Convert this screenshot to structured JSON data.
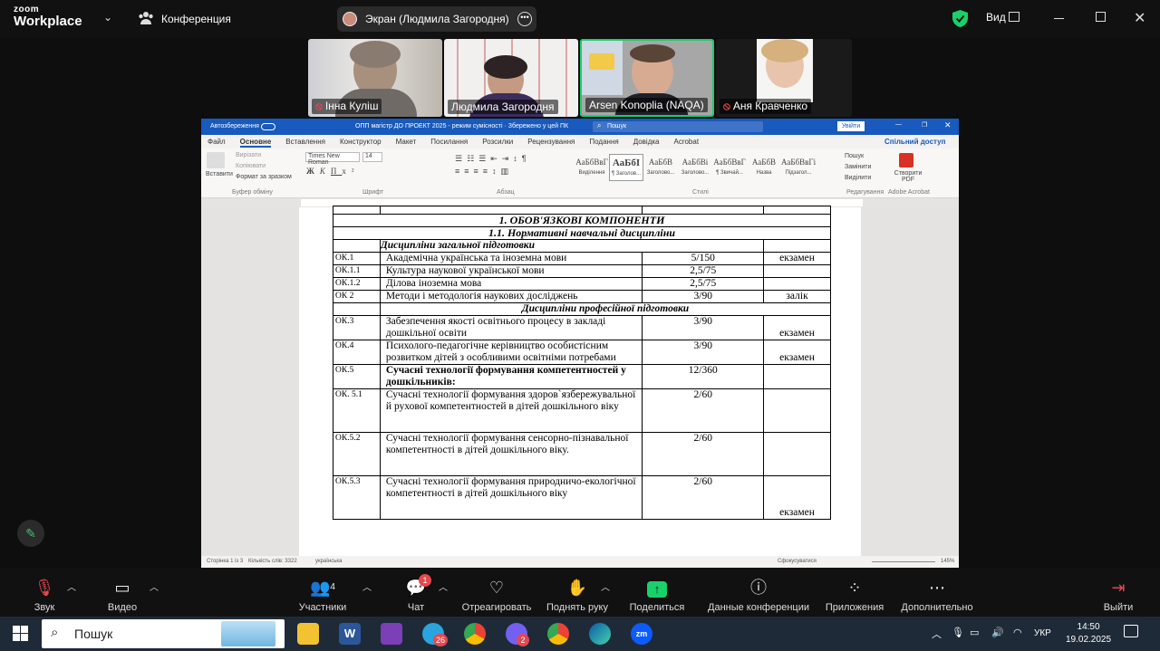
{
  "zoom": {
    "logo_top": "zoom",
    "logo_bottom": "Workplace",
    "conference_label": "Конференция",
    "share_label": "Экран (Людмила Загородня)",
    "view_label": "Вид"
  },
  "participants": [
    {
      "name": "Інна Куліш",
      "muted": true
    },
    {
      "name": "Людмила Загородня",
      "muted": false
    },
    {
      "name": "Arsen Konoplia (NAQA)",
      "muted": false,
      "active": true
    },
    {
      "name": "Аня Кравченко",
      "muted": true
    }
  ],
  "word": {
    "autosave": "Автозбереження",
    "doc_title": "ОПП магістр ДО ПРОЕКТ 2025 - режим сумісності · Збережено у цей ПК",
    "search_placeholder": "Пошук",
    "signin": "Увійти",
    "tabs": [
      "Файл",
      "Основне",
      "Вставлення",
      "Конструктор",
      "Макет",
      "Посилання",
      "Розсилки",
      "Рецензування",
      "Подання",
      "Довідка",
      "Acrobat"
    ],
    "share": "Спільний доступ",
    "ribbon": {
      "paste": "Вставити",
      "cut": "Вирізати",
      "copy": "Копіювати",
      "format_painter": "Формат за зразком",
      "clipboard": "Буфер обміну",
      "font_name": "Times New Roman",
      "font_size": "14",
      "font_group": "Шрифт",
      "paragraph_group": "Абзац",
      "styles": [
        {
          "preview": "АаБбВвГ",
          "label": "Виділення"
        },
        {
          "preview": "АаБбІ",
          "label": "¶ Заголов..."
        },
        {
          "preview": "АаБбВ",
          "label": "Заголово..."
        },
        {
          "preview": "АаБбВі",
          "label": "Заголово..."
        },
        {
          "preview": "АаБбВвГ",
          "label": "¶ Звичай..."
        },
        {
          "preview": "АаБбВ",
          "label": "Назва"
        },
        {
          "preview": "АаБбВвГі",
          "label": "Підзагол..."
        }
      ],
      "styles_group": "Стилі",
      "find": "Пошук",
      "replace": "Замінити",
      "select": "Виділити",
      "editing_group": "Редагування",
      "create_pdf": "Створити PDF",
      "acrobat_group": "Adobe Acrobat"
    },
    "status": {
      "page": "Сторінка 1 із 3",
      "words": "Кількість слів: 3322",
      "language": "українська",
      "focus": "Сфокусуватися",
      "zoom": "145%"
    }
  },
  "doc_table": {
    "section_title": "1. ОБОВ'ЯЗКОВІ КОМПОНЕНТИ",
    "subsection_title": "1.1. Нормативні навчальні дисципліни",
    "group1": "Дисципліни загальної підготовки",
    "group2": "Дисципліни професійної підготовки",
    "rows1": [
      {
        "code": "ОК.1",
        "name": "Академічна українська та іноземна мови",
        "credits": "5/150",
        "form": "екзамен"
      },
      {
        "code": "ОК.1.1",
        "name": "Культура наукової української мови",
        "credits": "2,5/75",
        "form": ""
      },
      {
        "code": "ОК.1.2",
        "name": "Ділова іноземна мова",
        "credits": "2,5/75",
        "form": ""
      },
      {
        "code": "ОК 2",
        "name": "Методи і методологія наукових досліджень",
        "credits": "3/90",
        "form": "залік"
      }
    ],
    "rows2": [
      {
        "code": "ОК.3",
        "name": "Забезпечення якості освітнього процесу в закладі дошкільної освіти",
        "credits": "3/90",
        "form": "екзамен"
      },
      {
        "code": "ОК.4",
        "name": "Психолого-педагогічне керівництво особистісним розвитком дітей з особливими освітніми потребами",
        "credits": "3/90",
        "form": "екзамен"
      },
      {
        "code": "ОК.5",
        "name": "Сучасні технології формування компетентностей у дошкільників:",
        "credits": "12/360",
        "form": ""
      },
      {
        "code": "ОК. 5.1",
        "name": "Сучасні технології формування здоров`язбережувальної й рухової компетентностей в дітей дошкільного віку",
        "credits": "2/60",
        "form": ""
      },
      {
        "code": "ОК.5.2",
        "name": "Сучасні технології формування сенсорно-пізнавальної компетентності в дітей дошкільного віку.",
        "credits": "2/60",
        "form": ""
      },
      {
        "code": "ОК.5.3",
        "name": "Сучасні технології формування природничо-екологічної компетентності в дітей дошкільного віку",
        "credits": "2/60",
        "form": "екзамен"
      }
    ]
  },
  "toolbar": {
    "audio": "Звук",
    "video": "Видео",
    "participants": "Участники",
    "participants_count": "4",
    "chat": "Чат",
    "chat_badge": "1",
    "react": "Отреагировать",
    "raise_hand": "Поднять руку",
    "share": "Поделиться",
    "meeting_info": "Данные конференции",
    "apps": "Приложения",
    "more": "Дополнительно",
    "leave": "Выйти"
  },
  "taskbar": {
    "search": "Пошук",
    "telegram_badge": "26",
    "viber_badge": "2",
    "lang": "УКР",
    "time": "14:50",
    "date": "19.02.2025"
  },
  "colors": {
    "word_blue": "#185abd",
    "zoom_green": "#19d16b",
    "leave_red": "#e5484d"
  }
}
